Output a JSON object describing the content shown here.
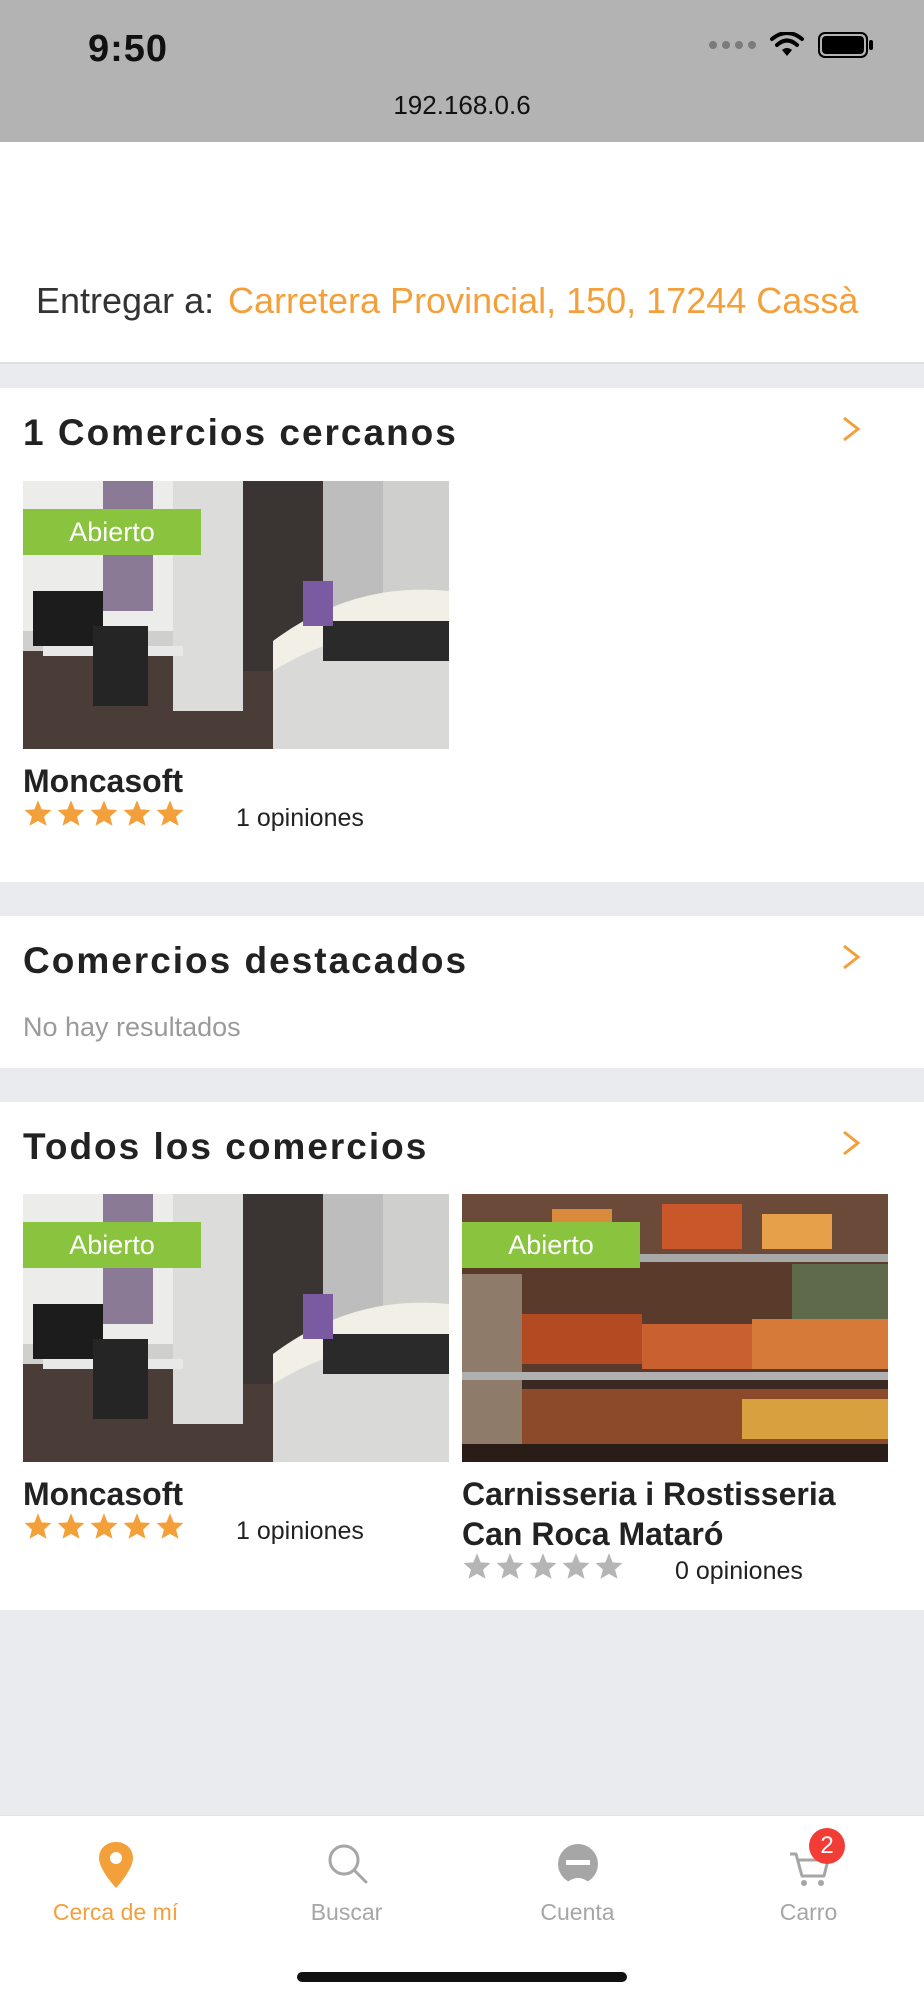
{
  "status_bar": {
    "time": "9:50",
    "url": "192.168.0.6"
  },
  "delivery": {
    "label": "Entregar a:",
    "address": "Carretera Provincial, 150, 17244 Cassà"
  },
  "nearby": {
    "title": "1 Comercios cercanos",
    "stores": [
      {
        "badge": "Abierto",
        "name": "Moncasoft",
        "rating": 5,
        "reviews": "1 opiniones"
      }
    ]
  },
  "featured": {
    "title": "Comercios destacados",
    "empty_text": "No hay resultados"
  },
  "all": {
    "title": "Todos los comercios",
    "stores": [
      {
        "badge": "Abierto",
        "name": "Moncasoft",
        "rating": 5,
        "reviews": "1 opiniones"
      },
      {
        "badge": "Abierto",
        "name": "Carnisseria i Rostisseria Can Roca Mataró",
        "name_line1": "Carnisseria i Rostisseria",
        "name_line2": "Can Roca Mataró",
        "rating": 0,
        "reviews": "0 opiniones"
      }
    ]
  },
  "tabbar": {
    "tabs": [
      {
        "label": "Cerca de mí",
        "icon": "map-pin-icon",
        "active": true
      },
      {
        "label": "Buscar",
        "icon": "search-icon",
        "active": false
      },
      {
        "label": "Cuenta",
        "icon": "user-icon",
        "active": false
      },
      {
        "label": "Carro",
        "icon": "cart-icon",
        "active": false,
        "badge": "2"
      }
    ]
  },
  "colors": {
    "accent": "#f4a03a",
    "open_badge": "#8ac43f",
    "star_filled": "#f4a03a",
    "star_empty": "#b5b5b5",
    "cart_badge": "#f23c36"
  }
}
